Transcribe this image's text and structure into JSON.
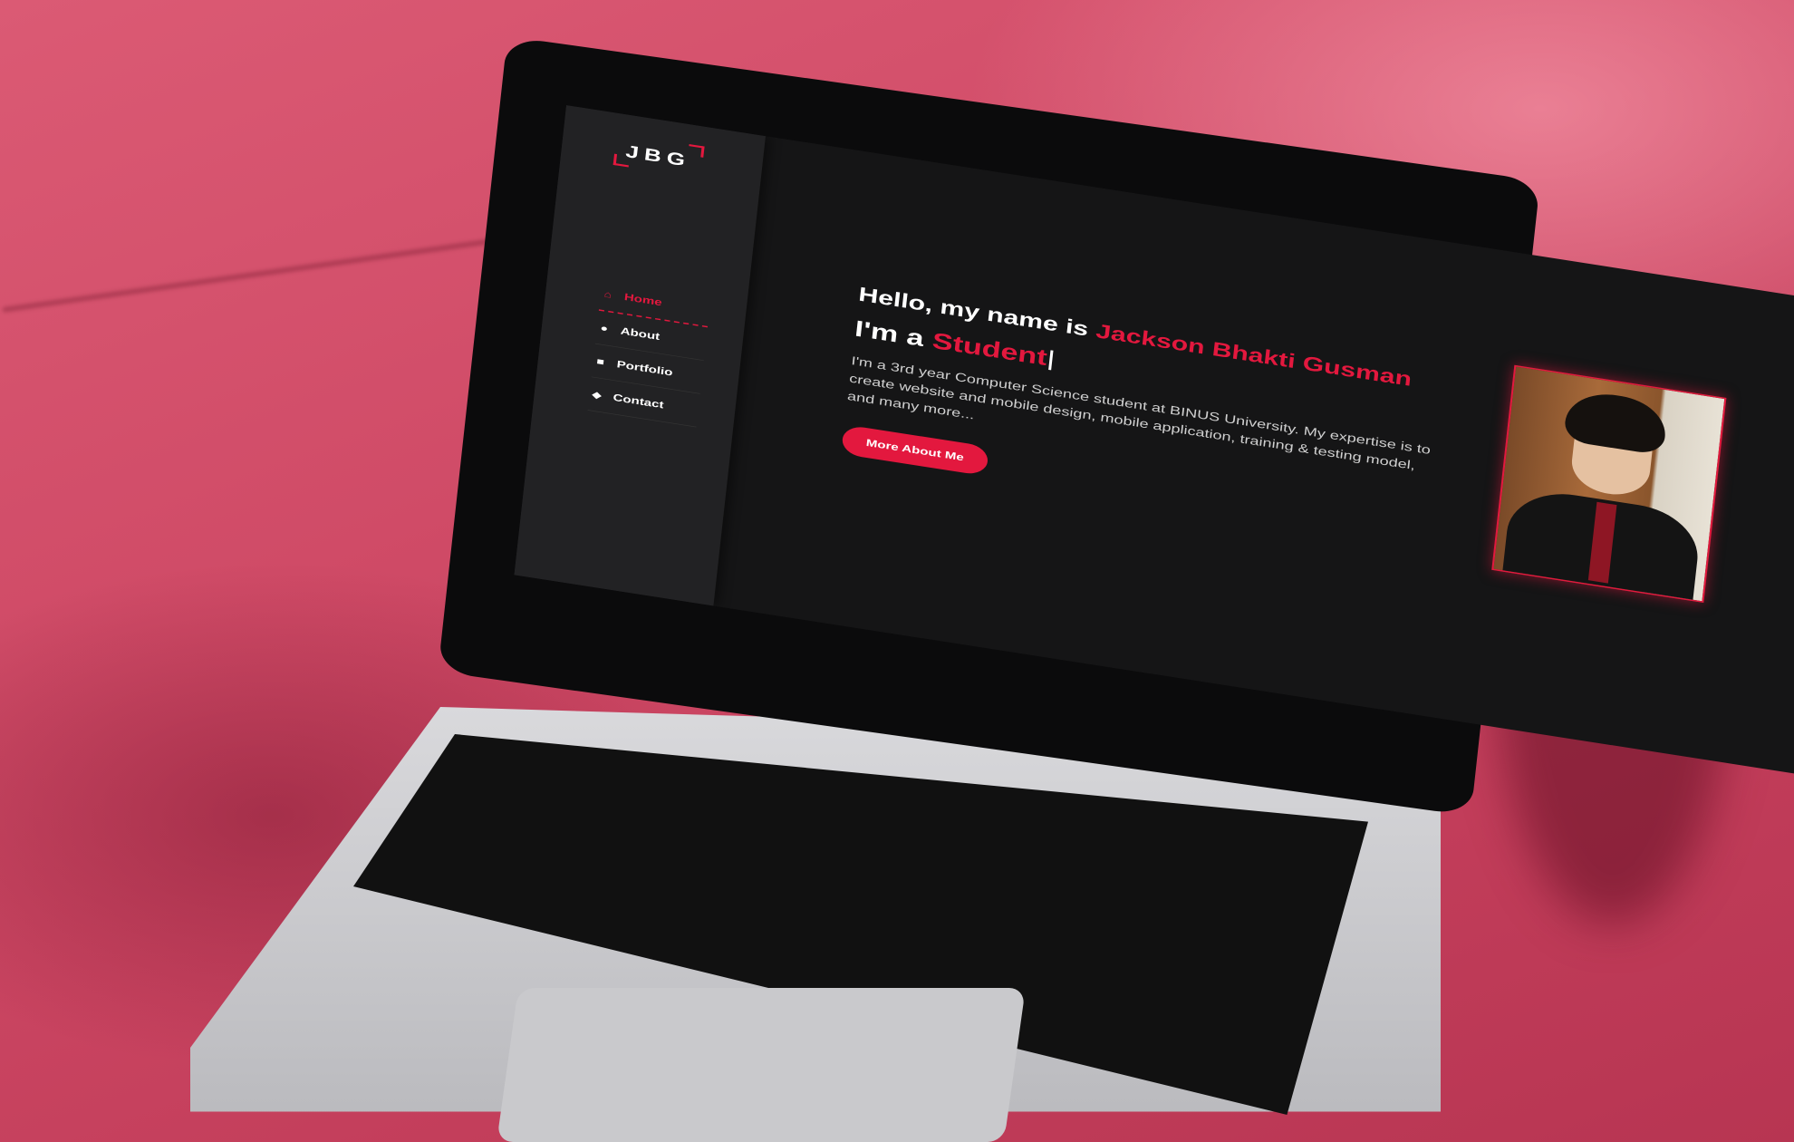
{
  "site": {
    "logo": "JBG",
    "nav": [
      {
        "label": "Home",
        "icon": "home-icon",
        "active": true
      },
      {
        "label": "About",
        "icon": "user-icon",
        "active": false
      },
      {
        "label": "Portfolio",
        "icon": "briefcase-icon",
        "active": false
      },
      {
        "label": "Contact",
        "icon": "chat-icon",
        "active": false
      }
    ],
    "hero": {
      "greeting": "Hello, my name is",
      "name": "Jackson Bhakti Gusman",
      "role_prefix": "I'm a",
      "role": "Student",
      "description": "I'm a 3rd year Computer Science student at BINUS University. My expertise is to create website and mobile design, mobile application, training & testing model, and many more...",
      "cta_label": "More About Me"
    },
    "colors": {
      "accent": "#e3183e",
      "background": "#151516",
      "sidebar": "#222224"
    }
  }
}
